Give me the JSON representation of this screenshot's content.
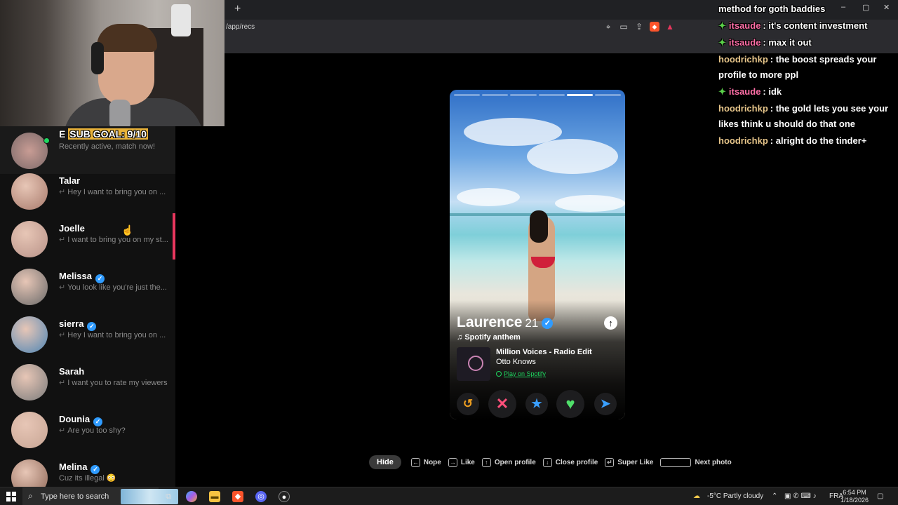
{
  "browser": {
    "new_tab": "+",
    "url": "/app/recs",
    "window_controls": [
      "–",
      "▢",
      "✕"
    ]
  },
  "overlay": {
    "sub_goal_prefix": "E",
    "sub_goal": "SUB GOAL: 9/10"
  },
  "sidebar": {
    "first": {
      "status": "Recently active, match now!"
    },
    "conversations": [
      {
        "name": "Talar",
        "verified": false,
        "message": "Hey I want to bring you on ...",
        "reply": true,
        "avatar_color": "#a87a6c"
      },
      {
        "name": "Joelle",
        "verified": false,
        "message": "I want to bring you on my st...",
        "reply": true,
        "avatar_color": "#b89288"
      },
      {
        "name": "Melissa",
        "verified": true,
        "message": "You look like you're just the...",
        "reply": true,
        "avatar_color": "#6a6a6a"
      },
      {
        "name": "sierra",
        "verified": true,
        "message": "Hey I want to bring you on ...",
        "reply": true,
        "avatar_color": "#4f86b5"
      },
      {
        "name": "Sarah",
        "verified": false,
        "message": "I want you to rate my viewers",
        "reply": true,
        "avatar_color": "#7c7c7c"
      },
      {
        "name": "Dounia",
        "verified": true,
        "message": "Are you too shy?",
        "reply": true,
        "avatar_color": "#c7a594"
      },
      {
        "name": "Melina",
        "verified": true,
        "message": "Cuz its illegal 😳",
        "reply": false,
        "avatar_color": "#8d6656"
      }
    ]
  },
  "profile": {
    "name": "Laurence",
    "age": "21",
    "photo_count": 6,
    "current_photo": 5,
    "anthem_label": "Spotify anthem",
    "song": "Million Voices - Radio Edit",
    "artist": "Otto Knows",
    "spotify_link": "Play on Spotify"
  },
  "actions": [
    {
      "name": "rewind-button",
      "glyph": "↺",
      "color": "#f0a020"
    },
    {
      "name": "nope-button",
      "glyph": "✕",
      "color": "#ff4f7a"
    },
    {
      "name": "super-like-button",
      "glyph": "★",
      "color": "#3aa0ff"
    },
    {
      "name": "like-button",
      "glyph": "♥",
      "color": "#4fe06a"
    },
    {
      "name": "boost-button",
      "glyph": "➤",
      "color": "#3aa0ff"
    }
  ],
  "hints": {
    "hide": "Hide",
    "nope": "Nope",
    "like": "Like",
    "open_profile": "Open profile",
    "close_profile": "Close profile",
    "super_like": "Super Like",
    "next_photo": "Next photo"
  },
  "chat": [
    {
      "badge": false,
      "user": "",
      "user_color": "",
      "text": "method for goth baddies"
    },
    {
      "badge": true,
      "user": "itsaude",
      "user_color": "#ff6fa7",
      "text": ": it's content investment"
    },
    {
      "badge": true,
      "user": "itsaude",
      "user_color": "#ff6fa7",
      "text": ": max it out"
    },
    {
      "badge": false,
      "user": "hoodrichkp",
      "user_color": "#e6c58a",
      "text": ": the boost spreads your profile to more ppl"
    },
    {
      "badge": true,
      "user": "itsaude",
      "user_color": "#ff6fa7",
      "text": ": idk"
    },
    {
      "badge": false,
      "user": "hoodrichkp",
      "user_color": "#e6c58a",
      "text": ": the gold lets you see your likes think u should do that one"
    },
    {
      "badge": false,
      "user": "hoodrichkp",
      "user_color": "#e6c58a",
      "text": ": alright do the tinder+"
    }
  ],
  "taskbar": {
    "search_placeholder": "Type here to search",
    "weather": "-5°C  Partly cloudy",
    "language": "FRA",
    "time": "6:54 PM",
    "date": "1/18/2026"
  }
}
